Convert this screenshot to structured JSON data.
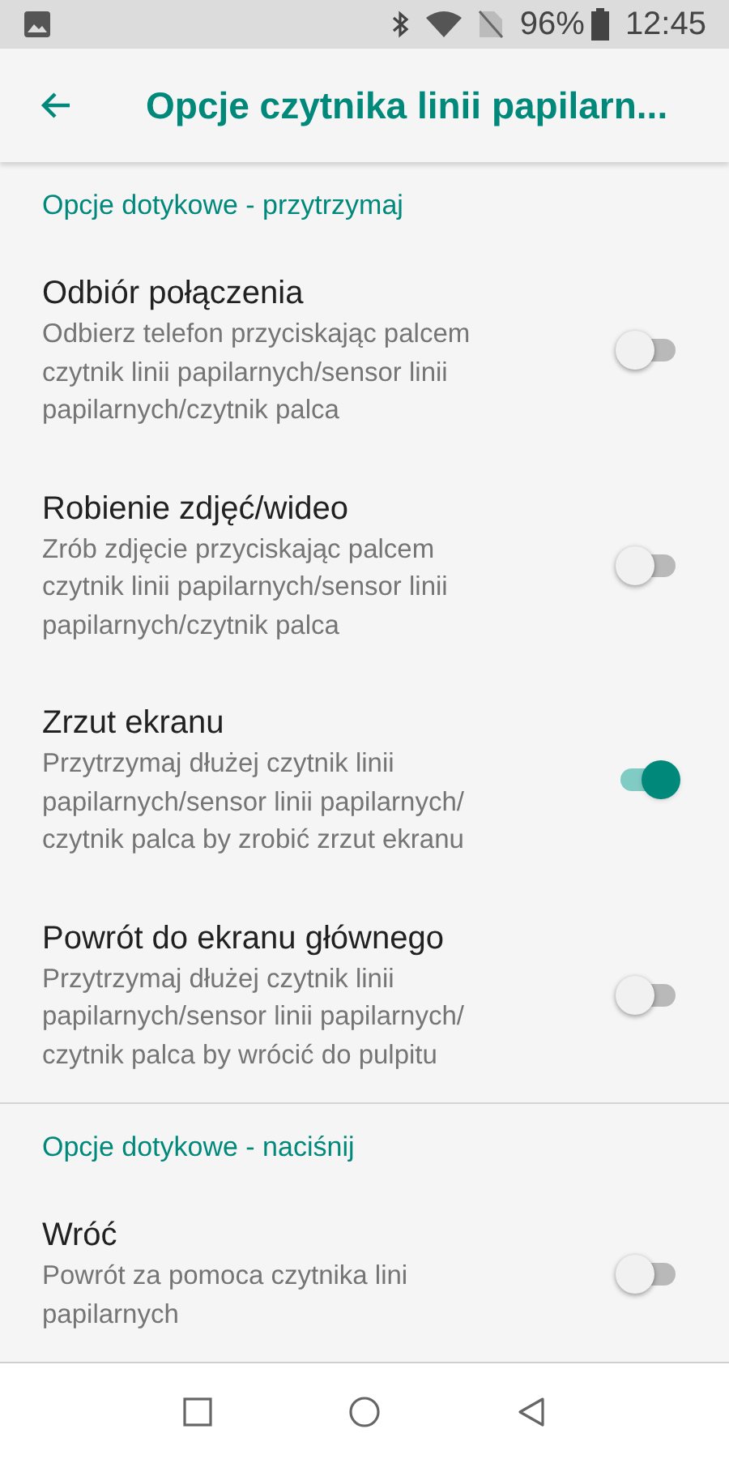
{
  "status_bar": {
    "battery": "96%",
    "time": "12:45"
  },
  "app_bar": {
    "title": "Opcje czytnika linii papilarn..."
  },
  "sections": [
    {
      "header": "Opcje dotykowe - przytrzymaj",
      "items": [
        {
          "title": "Odbiór połączenia",
          "summary": "Odbierz telefon przyciskając palcem czytnik linii papilarnych/sensor linii papilarnych/czytnik palca",
          "on": false
        },
        {
          "title": "Robienie zdjęć/wideo",
          "summary": "Zrób zdjęcie przyciskając palcem czytnik linii papilarnych/sensor linii papilarnych/czytnik palca",
          "on": false
        },
        {
          "title": "Zrzut ekranu",
          "summary": "Przytrzymaj dłużej czytnik linii papilarnych/sensor linii papilarnych/ czytnik palca by zrobić zrzut ekranu",
          "on": true
        },
        {
          "title": "Powrót do ekranu głównego",
          "summary": "Przytrzymaj dłużej czytnik linii papilarnych/sensor linii papilarnych/ czytnik palca by wrócić do pulpitu",
          "on": false
        }
      ]
    },
    {
      "header": "Opcje dotykowe - naciśnij",
      "items": [
        {
          "title": "Wróć",
          "summary": "Powrót za pomoca czytnika lini papilarnych",
          "on": false
        }
      ]
    }
  ]
}
